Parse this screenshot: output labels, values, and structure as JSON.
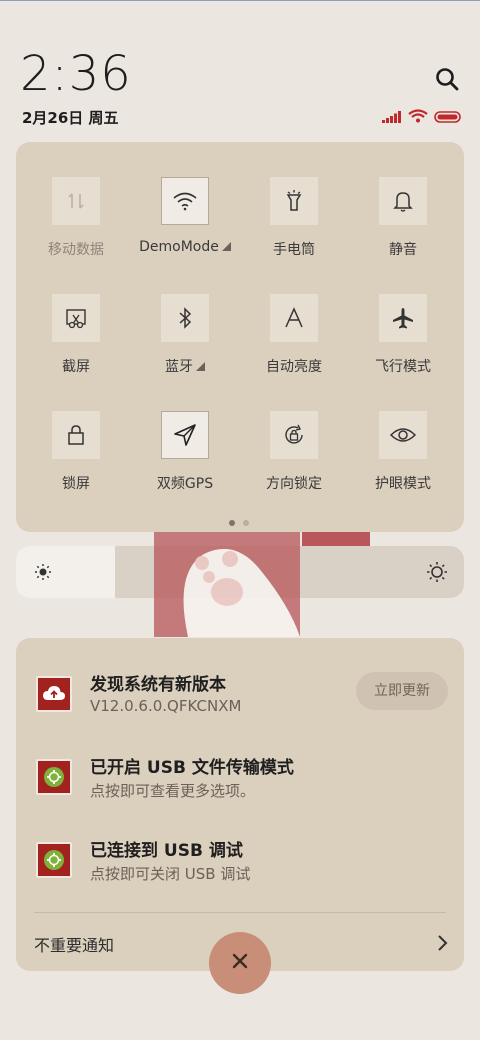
{
  "status": {
    "time": "2:36",
    "date": "2月26日 周五"
  },
  "icons": {
    "search": "search-icon",
    "signal": "signal-icon",
    "wifi": "wifi-icon",
    "battery": "battery-icon"
  },
  "quick_settings": {
    "tiles": [
      {
        "label": "移动数据",
        "icon": "mobile-data-icon",
        "state": "disabled"
      },
      {
        "label": "DemoMode",
        "icon": "wifi-icon",
        "state": "on"
      },
      {
        "label": "手电筒",
        "icon": "flashlight-icon",
        "state": "off"
      },
      {
        "label": "静音",
        "icon": "bell-icon",
        "state": "off"
      },
      {
        "label": "截屏",
        "icon": "screenshot-icon",
        "state": "off"
      },
      {
        "label": "蓝牙",
        "icon": "bluetooth-icon",
        "state": "off"
      },
      {
        "label": "自动亮度",
        "icon": "auto-brightness-icon",
        "state": "off"
      },
      {
        "label": "飞行模式",
        "icon": "airplane-icon",
        "state": "off"
      },
      {
        "label": "锁屏",
        "icon": "lock-icon",
        "state": "off"
      },
      {
        "label": "双频GPS",
        "icon": "location-icon",
        "state": "on"
      },
      {
        "label": "方向锁定",
        "icon": "rotation-lock-icon",
        "state": "off"
      },
      {
        "label": "护眼模式",
        "icon": "eye-icon",
        "state": "off"
      }
    ],
    "page_index": 1,
    "page_count": 2
  },
  "brightness": {
    "level_fraction": 0.22
  },
  "notifications": [
    {
      "title": "发现系统有新版本",
      "subtitle": "V12.0.6.0.QFKCNXM",
      "action": "立即更新",
      "icon": "cloud-upload-icon"
    },
    {
      "title": "已开启 USB 文件传输模式",
      "subtitle": "点按即可查看更多选项。",
      "icon": "android-icon"
    },
    {
      "title": "已连接到 USB 调试",
      "subtitle": "点按即可关闭 USB 调试",
      "icon": "android-icon"
    }
  ],
  "minor_notifications": {
    "label": "不重要通知"
  },
  "colors": {
    "accent": "#a1221e",
    "panel": "#dbcfbe",
    "close_button": "#c98e78",
    "battery": "#c0282c"
  }
}
